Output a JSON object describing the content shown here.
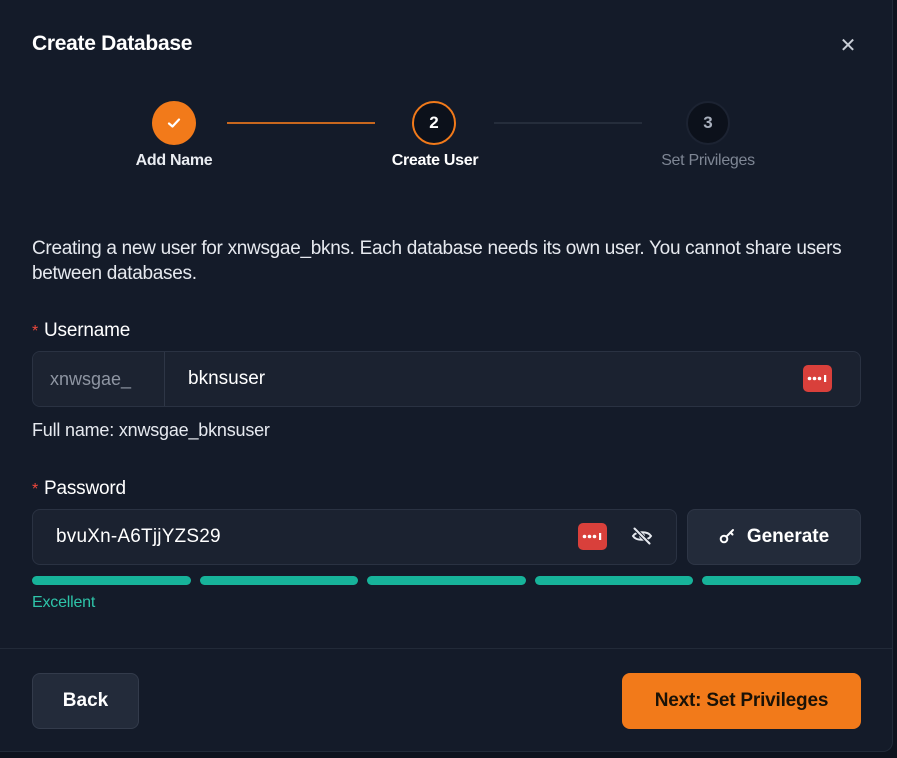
{
  "dialog": {
    "title": "Create Database",
    "close_icon": "close-icon"
  },
  "stepper": {
    "steps": [
      {
        "number": "",
        "label": "Add Name",
        "state": "completed",
        "icon": "check-icon"
      },
      {
        "number": "2",
        "label": "Create User",
        "state": "active"
      },
      {
        "number": "3",
        "label": "Set Privileges",
        "state": "pending"
      }
    ]
  },
  "description": "Creating a new user for xnwsgae_bkns. Each database needs its own user. You cannot share users between databases.",
  "username": {
    "required_marker": "*",
    "label": "Username",
    "prefix": "xnwsgae_",
    "value": "bknsuser",
    "full_name": "Full name: xnwsgae_bknsuser",
    "password_manager_icon": "password-manager-icon"
  },
  "password": {
    "required_marker": "*",
    "label": "Password",
    "value": "bvuXn-A6TjjYZS29",
    "password_manager_icon": "password-manager-icon",
    "visibility_icon": "eye-off-icon",
    "generate_label": "Generate",
    "generate_icon": "key-icon",
    "strength": {
      "segments_filled": 5,
      "segments_total": 5,
      "label": "Excellent",
      "color": "#17b39a"
    }
  },
  "footer": {
    "back_label": "Back",
    "next_label": "Next: Set Privileges"
  },
  "colors": {
    "accent": "#f27a1a",
    "background": "#141b29",
    "required": "#f0483c",
    "strength": "#17b39a",
    "password_manager": "#d9403b"
  }
}
